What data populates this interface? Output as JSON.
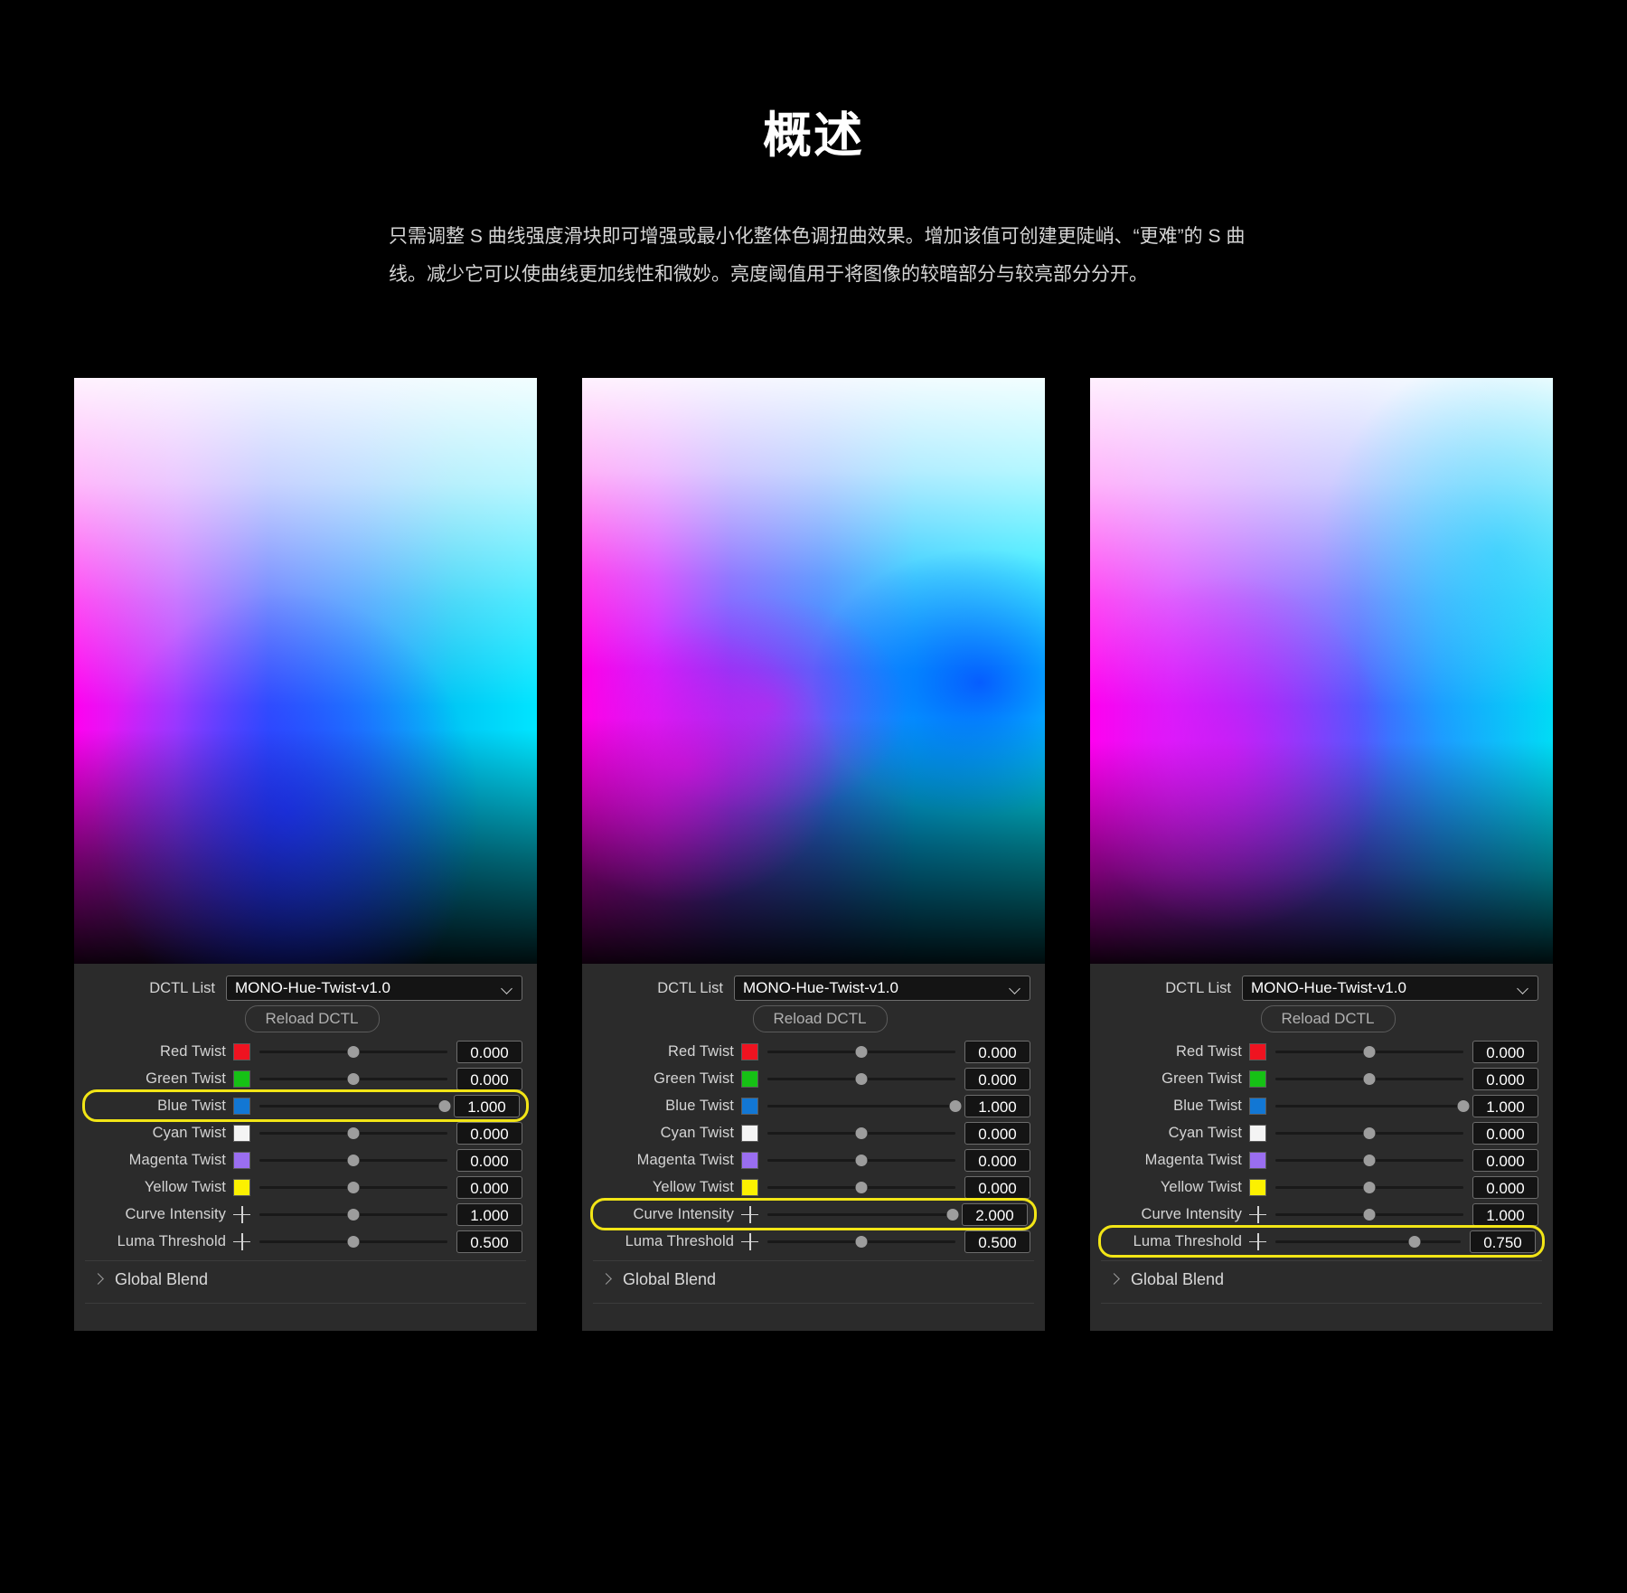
{
  "header": {
    "title": "概述",
    "paragraph": "只需调整 S 曲线强度滑块即可增强或最小化整体色调扭曲效果。增加该值可创建更陡峭、“更难”的 S 曲线。减少它可以使曲线更加线性和微妙。亮度阈值用于将图像的较暗部分与较亮部分分开。"
  },
  "colors": {
    "highlight": "#f2e516",
    "panel_bg": "#2b2b2b",
    "red_swatch": "#ef1320",
    "green_swatch": "#16c115",
    "blue_swatch": "#1277d4",
    "cyan_swatch": "#f4f4f4",
    "magenta_swatch": "#9a6ef0",
    "yellow_swatch": "#fcf100"
  },
  "panels": [
    {
      "dctl_label": "DCTL List",
      "dctl_value": "MONO-Hue-Twist-v1.0",
      "reload_label": "Reload DCTL",
      "global_blend_label": "Global Blend",
      "rows": [
        {
          "label": "Red Twist",
          "icon": "swatch-red",
          "value": "0.000",
          "pos": 50,
          "highlight": false
        },
        {
          "label": "Green Twist",
          "icon": "swatch-green",
          "value": "0.000",
          "pos": 50,
          "highlight": false
        },
        {
          "label": "Blue Twist",
          "icon": "swatch-blue",
          "value": "1.000",
          "pos": 100,
          "highlight": true
        },
        {
          "label": "Cyan Twist",
          "icon": "swatch-cyan",
          "value": "0.000",
          "pos": 50,
          "highlight": false
        },
        {
          "label": "Magenta Twist",
          "icon": "swatch-magenta",
          "value": "0.000",
          "pos": 50,
          "highlight": false
        },
        {
          "label": "Yellow Twist",
          "icon": "swatch-yellow",
          "value": "0.000",
          "pos": 50,
          "highlight": false
        },
        {
          "label": "Curve Intensity",
          "icon": "plus",
          "value": "1.000",
          "pos": 50,
          "highlight": false
        },
        {
          "label": "Luma Threshold",
          "icon": "plus",
          "value": "0.500",
          "pos": 50,
          "highlight": false
        }
      ]
    },
    {
      "dctl_label": "DCTL List",
      "dctl_value": "MONO-Hue-Twist-v1.0",
      "reload_label": "Reload DCTL",
      "global_blend_label": "Global Blend",
      "rows": [
        {
          "label": "Red Twist",
          "icon": "swatch-red",
          "value": "0.000",
          "pos": 50,
          "highlight": false
        },
        {
          "label": "Green Twist",
          "icon": "swatch-green",
          "value": "0.000",
          "pos": 50,
          "highlight": false
        },
        {
          "label": "Blue Twist",
          "icon": "swatch-blue",
          "value": "1.000",
          "pos": 100,
          "highlight": false
        },
        {
          "label": "Cyan Twist",
          "icon": "swatch-cyan",
          "value": "0.000",
          "pos": 50,
          "highlight": false
        },
        {
          "label": "Magenta Twist",
          "icon": "swatch-magenta",
          "value": "0.000",
          "pos": 50,
          "highlight": false
        },
        {
          "label": "Yellow Twist",
          "icon": "swatch-yellow",
          "value": "0.000",
          "pos": 50,
          "highlight": false
        },
        {
          "label": "Curve Intensity",
          "icon": "plus",
          "value": "2.000",
          "pos": 100,
          "highlight": true
        },
        {
          "label": "Luma Threshold",
          "icon": "plus",
          "value": "0.500",
          "pos": 50,
          "highlight": false
        }
      ]
    },
    {
      "dctl_label": "DCTL List",
      "dctl_value": "MONO-Hue-Twist-v1.0",
      "reload_label": "Reload DCTL",
      "global_blend_label": "Global Blend",
      "rows": [
        {
          "label": "Red Twist",
          "icon": "swatch-red",
          "value": "0.000",
          "pos": 50,
          "highlight": false
        },
        {
          "label": "Green Twist",
          "icon": "swatch-green",
          "value": "0.000",
          "pos": 50,
          "highlight": false
        },
        {
          "label": "Blue Twist",
          "icon": "swatch-blue",
          "value": "1.000",
          "pos": 100,
          "highlight": false
        },
        {
          "label": "Cyan Twist",
          "icon": "swatch-cyan",
          "value": "0.000",
          "pos": 50,
          "highlight": false
        },
        {
          "label": "Magenta Twist",
          "icon": "swatch-magenta",
          "value": "0.000",
          "pos": 50,
          "highlight": false
        },
        {
          "label": "Yellow Twist",
          "icon": "swatch-yellow",
          "value": "0.000",
          "pos": 50,
          "highlight": false
        },
        {
          "label": "Curve Intensity",
          "icon": "plus",
          "value": "1.000",
          "pos": 50,
          "highlight": false
        },
        {
          "label": "Luma Threshold",
          "icon": "plus",
          "value": "0.750",
          "pos": 75,
          "highlight": true
        }
      ]
    }
  ]
}
